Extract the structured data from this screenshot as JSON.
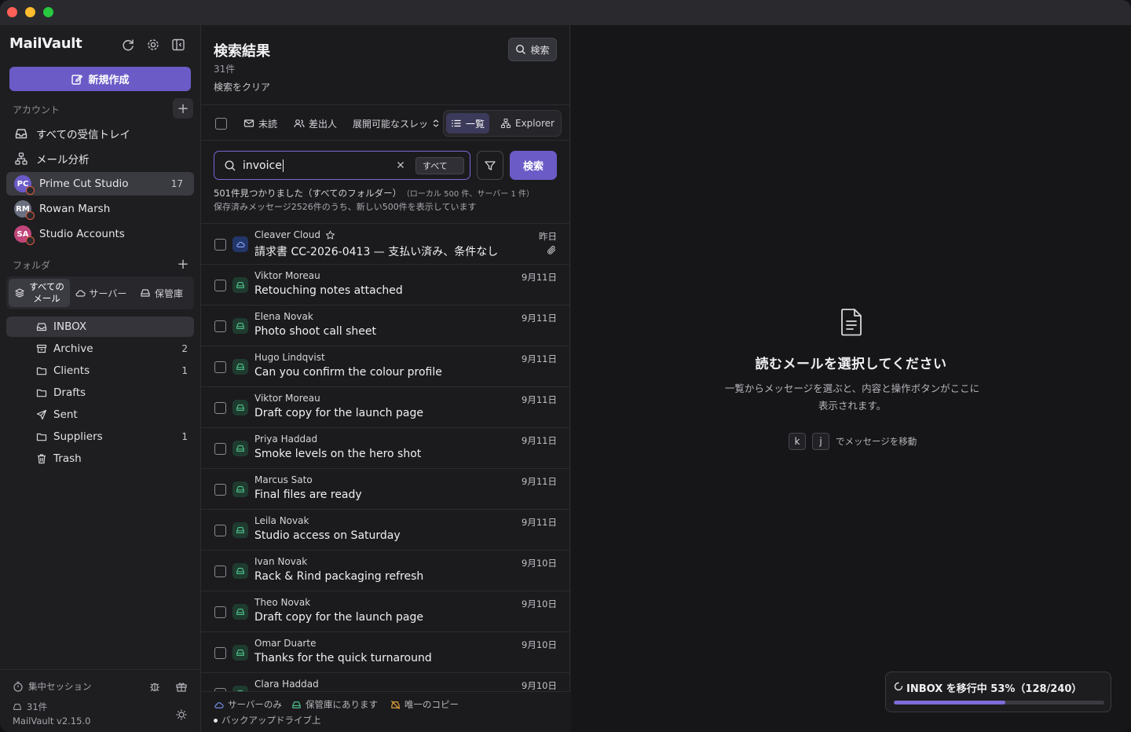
{
  "app": {
    "brand": "MailVault",
    "compose_label": "新規作成",
    "accent": "#6a5bc7"
  },
  "sidebar": {
    "accounts_label": "アカウント",
    "unified_inbox": "すべての受信トレイ",
    "analytics": "メール分析",
    "accounts": [
      {
        "initials": "PC",
        "name": "Prime Cut Studio",
        "count": "17",
        "color": "#6a5bc7"
      },
      {
        "initials": "RM",
        "name": "Rowan Marsh",
        "count": "",
        "color": "#6b7080"
      },
      {
        "initials": "SA",
        "name": "Studio Accounts",
        "count": "",
        "color": "#c0467a"
      }
    ],
    "folders_label": "フォルダ",
    "scope_tabs": [
      {
        "label": "すべての\nメール",
        "active": true
      },
      {
        "label": "サーバー",
        "active": false
      },
      {
        "label": "保管庫",
        "active": false
      }
    ],
    "folders": [
      {
        "name": "INBOX",
        "count": "",
        "icon": "inbox-icon"
      },
      {
        "name": "Archive",
        "count": "2",
        "icon": "archive-icon"
      },
      {
        "name": "Clients",
        "count": "1",
        "icon": "folder-icon"
      },
      {
        "name": "Drafts",
        "count": "",
        "icon": "folder-icon"
      },
      {
        "name": "Sent",
        "count": "",
        "icon": "send-icon"
      },
      {
        "name": "Suppliers",
        "count": "1",
        "icon": "folder-icon"
      },
      {
        "name": "Trash",
        "count": "",
        "icon": "trash-icon"
      }
    ],
    "footer": {
      "focus_session": "集中セッション",
      "stored_count": "31件",
      "version": "MailVault v2.15.0"
    }
  },
  "middle": {
    "title": "検索結果",
    "count": "31件",
    "clear": "検索をクリア",
    "search_button": "検索",
    "toolbar": {
      "unread": "未読",
      "sender": "差出人",
      "threads": "展開可能なスレッ",
      "list_view": "一覧",
      "explorer_view": "Explorer"
    },
    "search": {
      "value": "invoice",
      "scope": "すべて",
      "go": "検索"
    },
    "found_main": "501件見つかりました（すべてのフォルダー）",
    "found_sub": "（ローカル 500 件、サーバー 1 件）",
    "found_note": "保存済みメッセージ2526件のうち、新しい500件を表示しています",
    "messages": [
      {
        "from": "Cleaver Cloud",
        "subject": "請求書 CC-2026-0413 — 支払い済み、条件なし",
        "date": "昨日",
        "source": "cloud",
        "starred": true,
        "attachment": true
      },
      {
        "from": "Viktor Moreau",
        "subject": "Retouching notes attached",
        "date": "9月11日",
        "source": "vault"
      },
      {
        "from": "Elena Novak",
        "subject": "Photo shoot call sheet",
        "date": "9月11日",
        "source": "vault"
      },
      {
        "from": "Hugo Lindqvist",
        "subject": "Can you confirm the colour profile",
        "date": "9月11日",
        "source": "vault"
      },
      {
        "from": "Viktor Moreau",
        "subject": "Draft copy for the launch page",
        "date": "9月11日",
        "source": "vault"
      },
      {
        "from": "Priya Haddad",
        "subject": "Smoke levels on the hero shot",
        "date": "9月11日",
        "source": "vault"
      },
      {
        "from": "Marcus Sato",
        "subject": "Final files are ready",
        "date": "9月11日",
        "source": "vault"
      },
      {
        "from": "Leila Novak",
        "subject": "Studio access on Saturday",
        "date": "9月11日",
        "source": "vault"
      },
      {
        "from": "Ivan Novak",
        "subject": "Rack & Rind packaging refresh",
        "date": "9月10日",
        "source": "vault"
      },
      {
        "from": "Theo Novak",
        "subject": "Draft copy for the launch page",
        "date": "9月10日",
        "source": "vault"
      },
      {
        "from": "Omar Duarte",
        "subject": "Thanks for the quick turnaround",
        "date": "9月10日",
        "source": "vault"
      },
      {
        "from": "Clara Haddad",
        "subject": "",
        "date": "9月10日",
        "source": "vault"
      }
    ],
    "legend": {
      "server_only": "サーバーのみ",
      "in_vault": "保管庫にあります",
      "only_copy": "唯一のコピー",
      "backup_drive": "バックアップドライブ上"
    }
  },
  "reader": {
    "empty_title": "読むメールを選択してください",
    "empty_desc": "一覧からメッセージを選ぶと、内容と操作ボタンがここに表示されます。",
    "key_k": "k",
    "key_j": "j",
    "key_hint": "でメッセージを移動"
  },
  "toast": {
    "text": "INBOX を移行中 53%（128/240）",
    "progress": 0.53
  }
}
